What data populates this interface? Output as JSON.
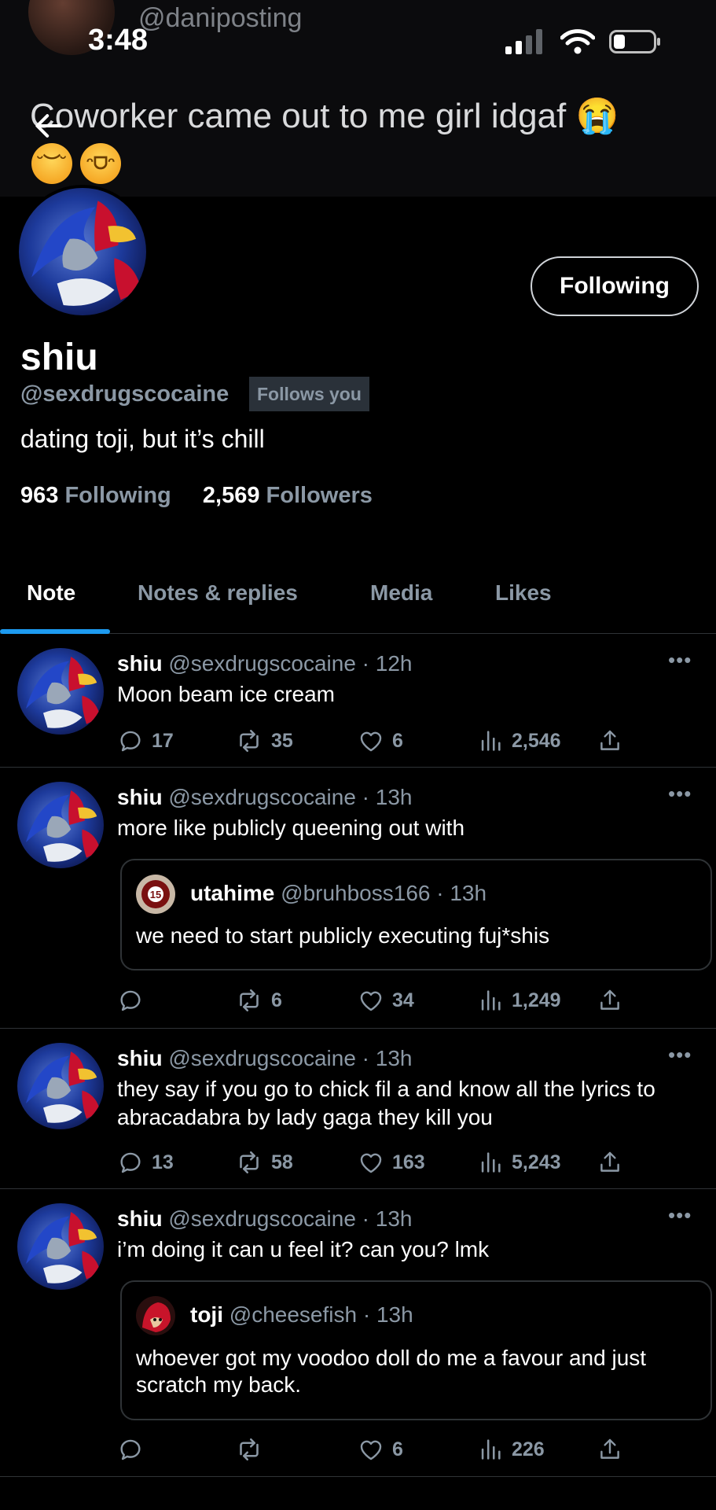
{
  "status_bar": {
    "time": "3:48"
  },
  "background": {
    "handle": "@daniposting",
    "tweet_text": "Coworker came out to me girl idgaf 😭"
  },
  "profile": {
    "display_name": "shiu",
    "handle": "@sexdrugscocaine",
    "follows_you": "Follows you",
    "bio": "dating toji, but it’s chill",
    "following_count": "963",
    "following_label": "Following",
    "followers_count": "2,569",
    "followers_label": "Followers",
    "follow_button": "Following"
  },
  "tabs": [
    "Note",
    "Notes & replies",
    "Media",
    "Likes"
  ],
  "accent_color": "#1d9bf0",
  "tweets": [
    {
      "name": "shiu",
      "meta": "@sexdrugscocaine · 12h",
      "text": "Moon beam ice cream",
      "replies": "17",
      "retweets": "35",
      "likes": "6",
      "views": "2,546"
    },
    {
      "name": "shiu",
      "meta": "@sexdrugscocaine · 13h",
      "text": "more like publicly queening out with",
      "quote": {
        "name": "utahime",
        "meta": "@bruhboss166 · 13h",
        "text": "we need to start publicly executing fuj*shis"
      },
      "replies": "",
      "retweets": "6",
      "likes": "34",
      "views": "1,249"
    },
    {
      "name": "shiu",
      "meta": "@sexdrugscocaine · 13h",
      "text": "they say if you go to chick fil a and know all the lyrics to abracadabra by lady gaga they kill you",
      "replies": "13",
      "retweets": "58",
      "likes": "163",
      "views": "5,243"
    },
    {
      "name": "shiu",
      "meta": "@sexdrugscocaine · 13h",
      "text": "i’m doing it can u feel it? can you? lmk",
      "quote": {
        "name": "toji",
        "meta": "@cheesefish · 13h",
        "text": "whoever got my voodoo doll do me a favour and just scratch my back."
      },
      "replies": "",
      "retweets": "",
      "likes": "6",
      "views": "226"
    }
  ],
  "more_glyph": "•••",
  "quote_badge": "15"
}
